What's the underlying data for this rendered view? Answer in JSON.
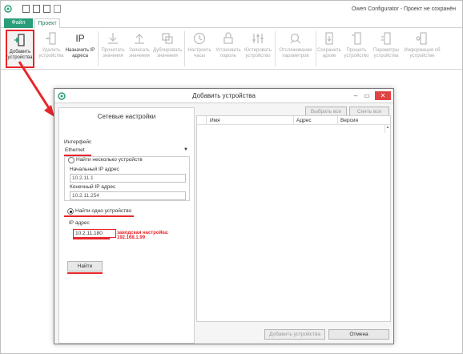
{
  "app": {
    "title": "Owen Configurator - Проект не сохранён",
    "tabs": {
      "file": "Файл",
      "project": "Проект"
    }
  },
  "ribbon": {
    "add_devices": "Добавить устройства",
    "remove_devices": "Удалить устройства",
    "assign_ip": "Назначить IP адреса",
    "assign_ip_icon_text": "IP",
    "read_values": "Прочитать значения",
    "write_values": "Записать значения",
    "duplicate_values": "Дублировать значения",
    "set_clock": "Настроить часы",
    "set_password": "Установить пароль",
    "configure_device": "Юстировать устройство",
    "track_params": "Отслеживание параметров",
    "save_archive": "Сохранить архив",
    "flash_device": "Прошить устройство",
    "device_params": "Параметры устройства",
    "device_info": "Информация об устройстве"
  },
  "dialog": {
    "title": "Добавить устройства",
    "left": {
      "heading": "Сетевые настройки",
      "interface_label": "Интерфейс",
      "interface_value": "Ethernet",
      "find_many_label": "Найти несколько устройств",
      "start_ip_label": "Начальный IP адрес",
      "start_ip_value": "10.2.11.1",
      "end_ip_label": "Конечный IP адрес",
      "end_ip_value": "10.2.11.254",
      "find_one_label": "Найти одно устройство",
      "ip_label": "IP адрес",
      "ip_value": "10.2.11.180",
      "factory_hint": "заводская настройка: 192.168.1.99",
      "find_button": "Найти"
    },
    "right": {
      "select_all": "Выбрать все",
      "clear_all": "Снять все",
      "columns": [
        "Имя",
        "Адрес",
        "Версия"
      ],
      "add_devices_button": "Добавить устройства",
      "cancel_button": "Отмена"
    }
  },
  "colors": {
    "accent": "#2a9d7a",
    "highlight": "#e8262b"
  }
}
